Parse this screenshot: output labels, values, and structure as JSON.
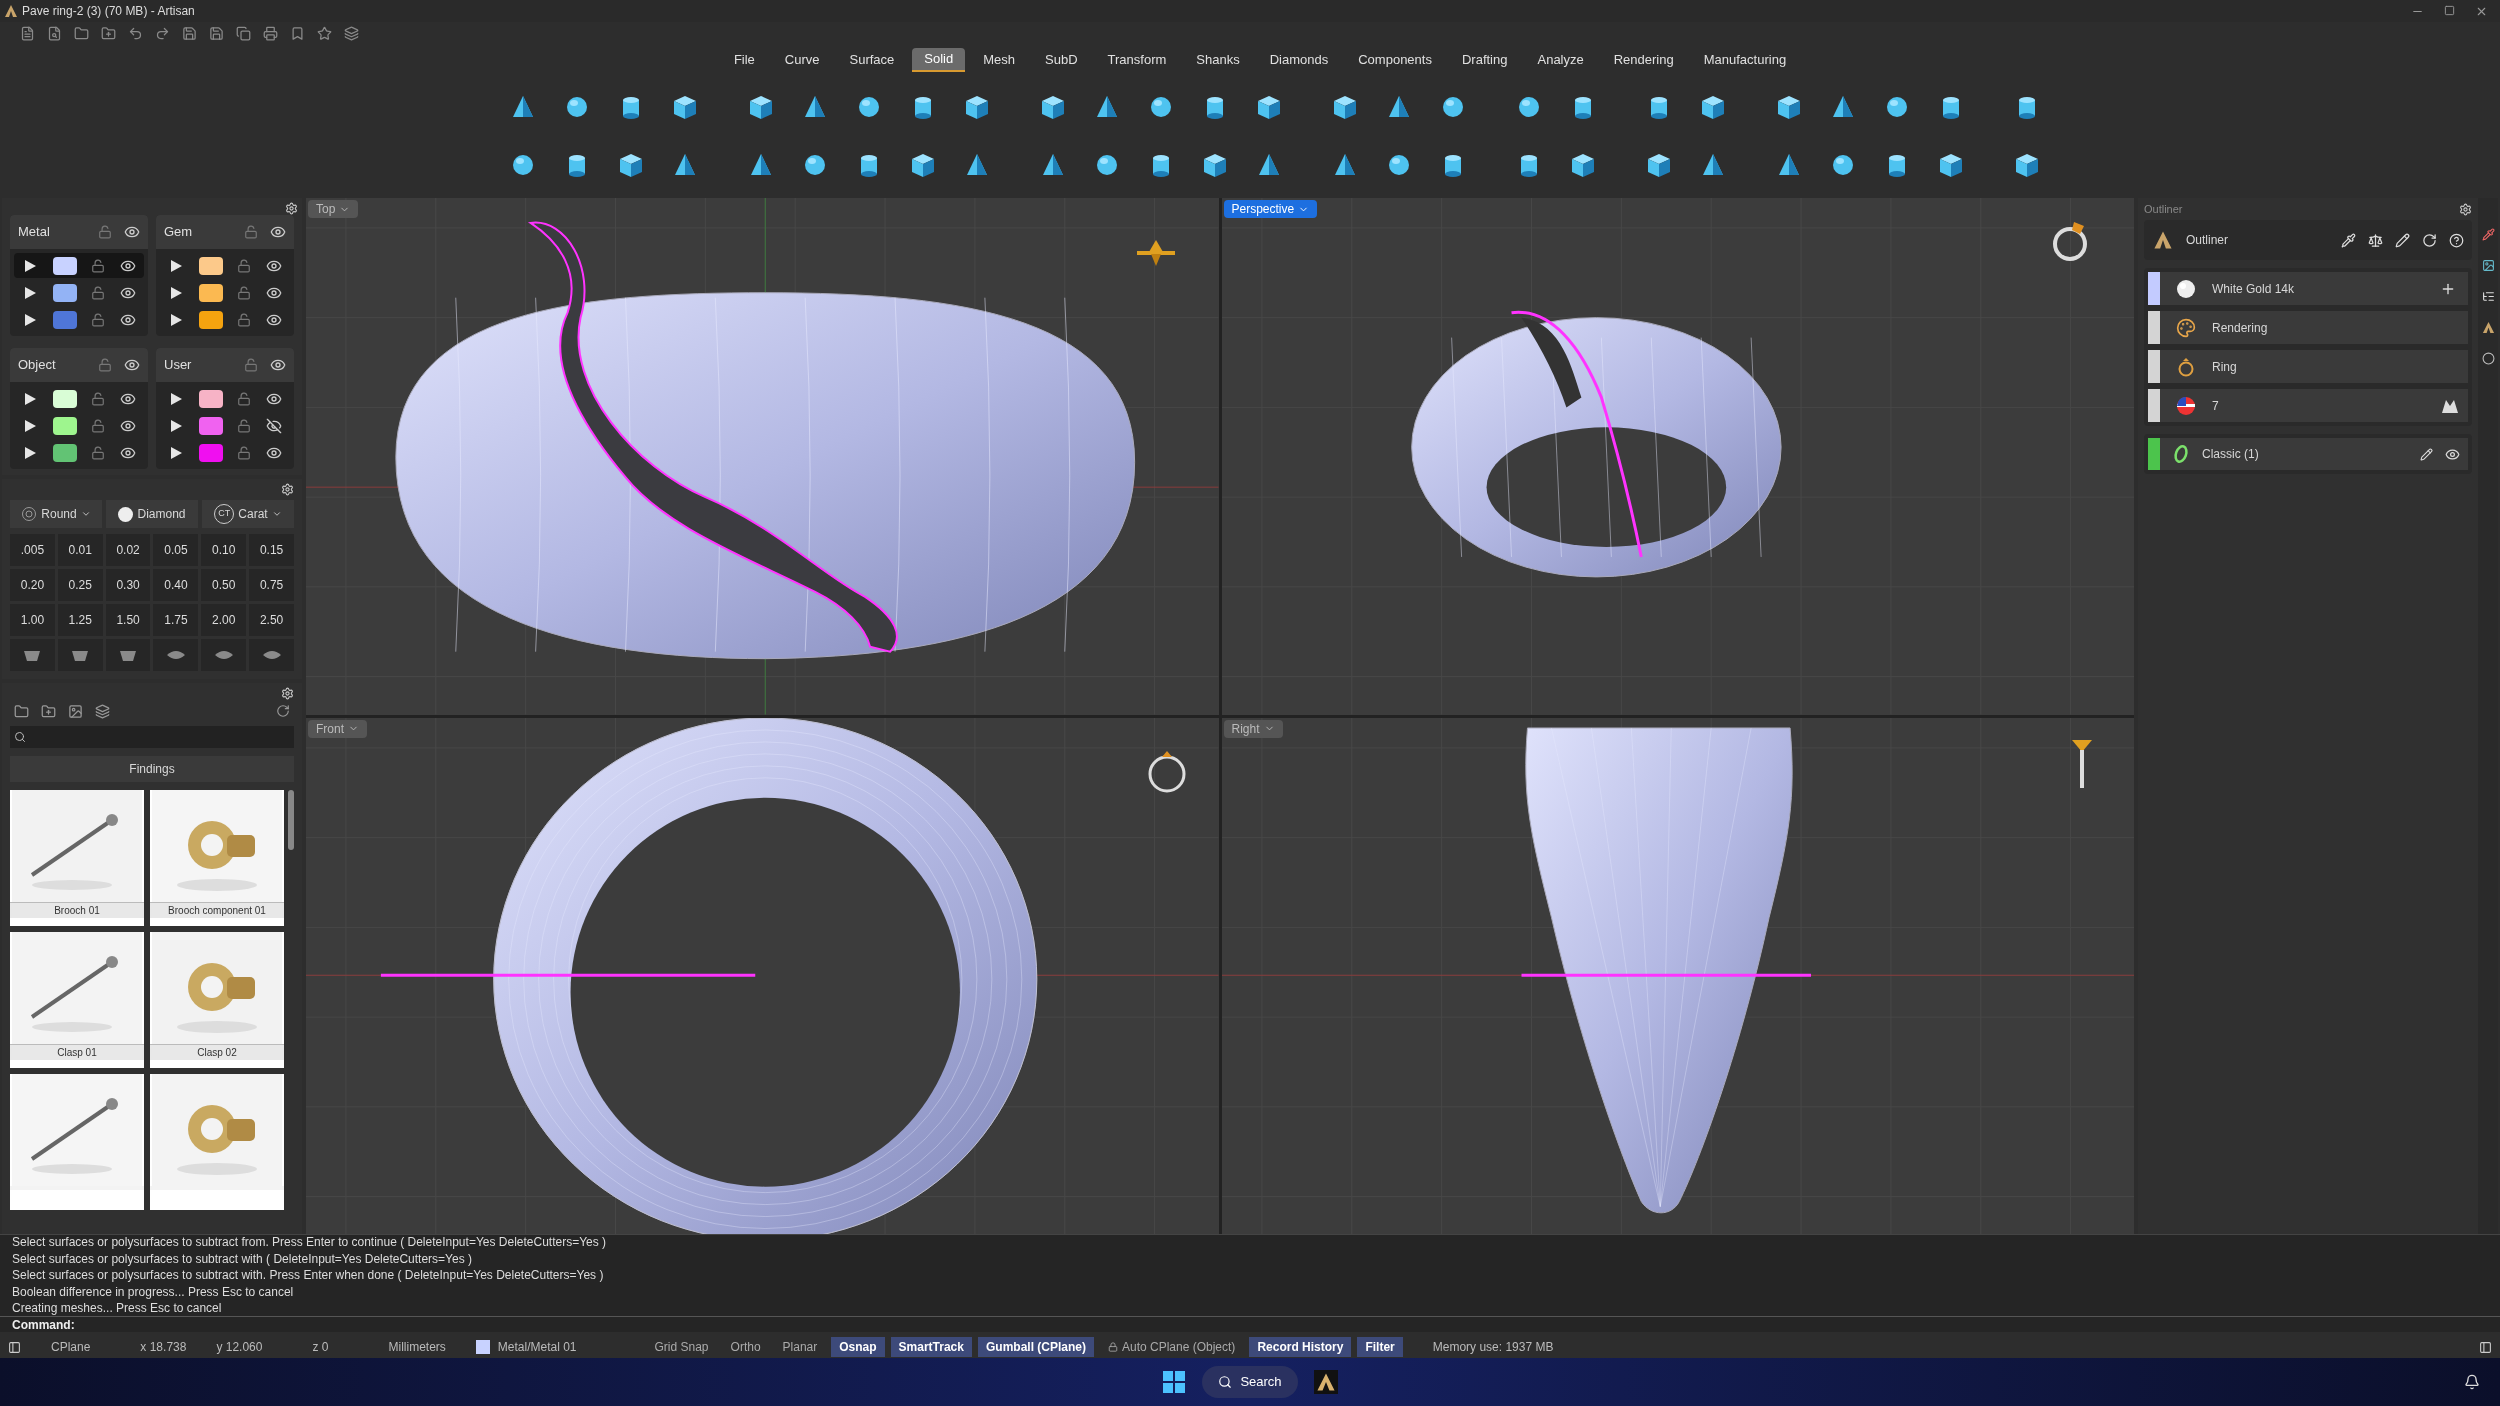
{
  "window": {
    "title": "Pave ring-2 (3) (70 MB) - Artisan"
  },
  "menu": [
    {
      "label": "File",
      "selected": false
    },
    {
      "label": "Curve",
      "selected": false
    },
    {
      "label": "Surface",
      "selected": false
    },
    {
      "label": "Solid",
      "selected": true
    },
    {
      "label": "Mesh",
      "selected": false
    },
    {
      "label": "SubD",
      "selected": false
    },
    {
      "label": "Transform",
      "selected": false
    },
    {
      "label": "Shanks",
      "selected": false
    },
    {
      "label": "Diamonds",
      "selected": false
    },
    {
      "label": "Components",
      "selected": false
    },
    {
      "label": "Drafting",
      "selected": false
    },
    {
      "label": "Analyze",
      "selected": false
    },
    {
      "label": "Rendering",
      "selected": false
    },
    {
      "label": "Manufacturing",
      "selected": false
    }
  ],
  "layers": [
    {
      "name": "Metal",
      "rows": [
        {
          "color": "#c8d2ff",
          "current": true,
          "visible": true
        },
        {
          "color": "#93b3f5",
          "current": false,
          "visible": true
        },
        {
          "color": "#4f76d8",
          "current": false,
          "visible": true
        }
      ]
    },
    {
      "name": "Gem",
      "rows": [
        {
          "color": "#fcc98a",
          "current": false,
          "visible": true
        },
        {
          "color": "#fbb951",
          "current": false,
          "visible": true
        },
        {
          "color": "#f5a30f",
          "current": false,
          "visible": true
        }
      ]
    },
    {
      "name": "Object",
      "rows": [
        {
          "color": "#d9fdd6",
          "current": false,
          "visible": true
        },
        {
          "color": "#9ef58e",
          "current": false,
          "visible": true
        },
        {
          "color": "#62c374",
          "current": false,
          "visible": true
        }
      ]
    },
    {
      "name": "User",
      "rows": [
        {
          "color": "#f7b3c6",
          "current": false,
          "visible": true
        },
        {
          "color": "#f062f0",
          "current": false,
          "visible": false
        },
        {
          "color": "#f00ff0",
          "current": false,
          "visible": true
        }
      ]
    }
  ],
  "gem_picker": {
    "shape": "Round",
    "stone": "Diamond",
    "unit": "Carat",
    "unit_badge": "CT"
  },
  "sizes": [
    ".005",
    "0.01",
    "0.02",
    "0.05",
    "0.10",
    "0.15",
    "0.20",
    "0.25",
    "0.30",
    "0.40",
    "0.50",
    "0.75",
    "1.00",
    "1.25",
    "1.50",
    "1.75",
    "2.00",
    "2.50"
  ],
  "library": {
    "title": "Findings",
    "items": [
      {
        "caption": "Brooch 01"
      },
      {
        "caption": "Brooch component 01"
      },
      {
        "caption": "Clasp 01"
      },
      {
        "caption": "Clasp 02"
      },
      {
        "kind": "picture"
      },
      {
        "kind": "picture"
      }
    ]
  },
  "viewports": [
    {
      "label": "Top",
      "selected": false
    },
    {
      "label": "Perspective",
      "selected": true
    },
    {
      "label": "Front",
      "selected": false
    },
    {
      "label": "Right",
      "selected": false
    }
  ],
  "outliner": {
    "panel_title": "Outliner",
    "title": "Outliner",
    "items": [
      {
        "label": "White Gold 14k",
        "color": "#c3cbff"
      },
      {
        "label": "Rendering",
        "color": "#d4d4d4"
      },
      {
        "label": "Ring",
        "color": "#d4d4d4"
      },
      {
        "label": "7",
        "color": "#d4d4d4"
      }
    ],
    "model": {
      "label": "Classic (1)",
      "color": "#4cc44c"
    }
  },
  "command": {
    "history": [
      "Select surfaces or polysurfaces to subtract from. Press Enter to continue ( DeleteInput=Yes  DeleteCutters=Yes )",
      "Select surfaces or polysurfaces to subtract with ( DeleteInput=Yes  DeleteCutters=Yes )",
      "Select surfaces or polysurfaces to subtract with. Press Enter when done ( DeleteInput=Yes  DeleteCutters=Yes )",
      "Boolean difference in progress... Press Esc to cancel",
      "Creating meshes... Press Esc to cancel"
    ],
    "prompt": "Command:"
  },
  "status": {
    "cplane": "CPlane",
    "x": "x 18.738",
    "y": "y 12.060",
    "z": "z 0",
    "units": "Millimeters",
    "layer": {
      "label": "Metal/Metal 01",
      "color": "#c8d2ff"
    },
    "toggles": [
      {
        "label": "Grid Snap",
        "on": false,
        "locked": false
      },
      {
        "label": "Ortho",
        "on": false,
        "locked": false
      },
      {
        "label": "Planar",
        "on": false,
        "locked": false
      },
      {
        "label": "Osnap",
        "on": true,
        "locked": false
      },
      {
        "label": "SmartTrack",
        "on": true,
        "locked": false
      },
      {
        "label": "Gumball (CPlane)",
        "on": true,
        "locked": false
      },
      {
        "label": "Auto CPlane (Object)",
        "on": false,
        "locked": true
      },
      {
        "label": "Record History",
        "on": true,
        "locked": false
      },
      {
        "label": "Filter",
        "on": true,
        "locked": false
      }
    ],
    "memory": "Memory use: 1937 MB"
  },
  "taskbar": {
    "search": "Search"
  }
}
